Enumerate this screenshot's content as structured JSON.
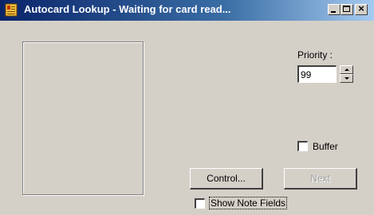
{
  "window": {
    "title": "Autocard Lookup - Waiting for card read...",
    "minimize_glyph": "_",
    "close_glyph": "×"
  },
  "priority": {
    "label": "Priority :",
    "value": "99"
  },
  "buffer": {
    "label": "Buffer",
    "checked": false
  },
  "buttons": {
    "control_label": "Control...",
    "next_label": "Next",
    "next_enabled": false
  },
  "notes": {
    "label": "Show Note Fields",
    "checked": false
  },
  "colors": {
    "titlebar_start": "#0a246a",
    "titlebar_end": "#a6caf0",
    "face": "#d4d0c8"
  }
}
